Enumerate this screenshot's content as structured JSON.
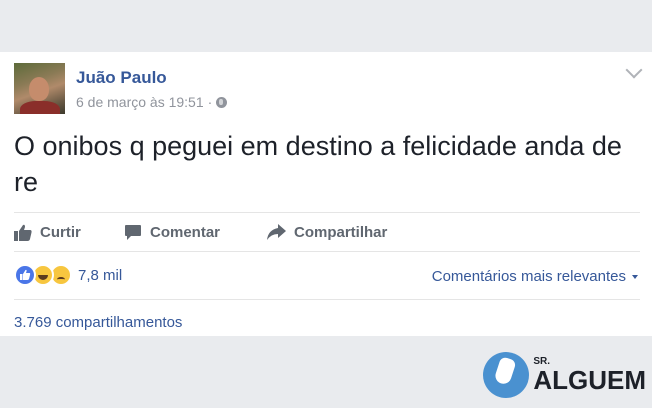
{
  "post": {
    "author": "Juão Paulo",
    "timestamp": "6 de março às 19:51",
    "separator": "·",
    "audience_icon": "globe-icon",
    "text": "O onibos q peguei em destino a felicidade anda de re"
  },
  "actions": {
    "like_label": "Curtir",
    "comment_label": "Comentar",
    "share_label": "Compartilhar"
  },
  "reactions": {
    "icons": [
      "like-icon",
      "haha-icon",
      "sad-icon"
    ],
    "count": "7,8 mil"
  },
  "comments_filter": {
    "label": "Comentários mais relevantes"
  },
  "shares": {
    "label": "3.769 compartilhamentos"
  },
  "watermark": {
    "prefix": "SR.",
    "name": "ALGUEM"
  },
  "colors": {
    "link": "#365899",
    "page_bg": "#e9ebee",
    "muted": "#90949c",
    "action_gray": "#606770"
  }
}
